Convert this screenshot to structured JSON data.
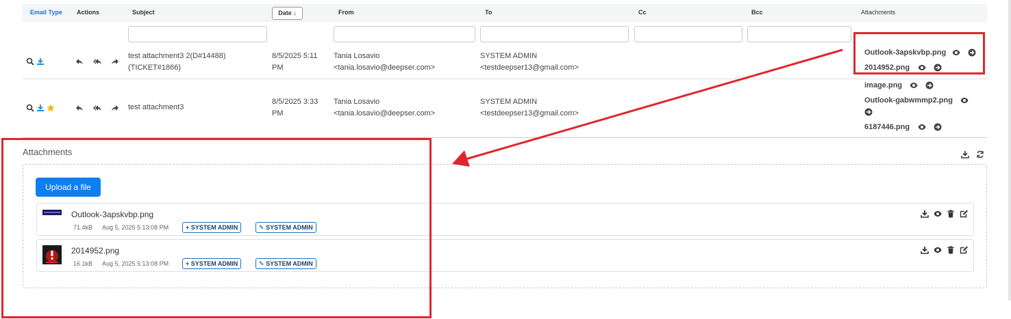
{
  "table": {
    "headers": {
      "email_type": "Email Type",
      "actions": "Actions",
      "subject": "Subject",
      "date": "Date",
      "from": "From",
      "to": "To",
      "cc": "Cc",
      "bcc": "Bcc",
      "attachments": "Attachments"
    },
    "rows": [
      {
        "subject_line1": "test attachment3 2(D#14488)",
        "subject_line2": "(TICKET#1866)",
        "date_line1": "8/5/2025 5:11",
        "date_line2": "PM",
        "from_name": "Tania Losavio",
        "from_email": "<tania.losavio@deepser.com>",
        "to_name": "SYSTEM ADMIN",
        "to_email": "<testdeepser13@gmail.com>",
        "attachments": [
          "Outlook-3apskvbp.png",
          "2014952.png"
        ]
      },
      {
        "subject_line1": "test attachment3",
        "date_line1": "8/5/2025 3:33",
        "date_line2": "PM",
        "from_name": "Tania Losavio",
        "from_email": "<tania.losavio@deepser.com>",
        "to_name": "SYSTEM ADMIN",
        "to_email": "<testdeepser13@gmail.com>",
        "attachments": [
          "image.png",
          "Outlook-gabwmmp2.png",
          "6187446.png"
        ]
      }
    ]
  },
  "panel": {
    "title": "Attachments",
    "upload_label": "Upload a file",
    "files": [
      {
        "name": "Outlook-3apskvbp.png",
        "size": "71.4kB",
        "date": "Aug 5, 2025 5:13:08 PM",
        "created_by": "+ SYSTEM ADMIN",
        "edited_by": "SYSTEM ADMIN"
      },
      {
        "name": "2014952.png",
        "size": "16.1kB",
        "date": "Aug 5, 2025 5:13:08 PM",
        "created_by": "+ SYSTEM ADMIN",
        "edited_by": "SYSTEM ADMIN"
      }
    ]
  },
  "colors": {
    "accent_blue": "#0d7ff2",
    "header_blue": "#1a73d9",
    "highlight_red": "#e0262b",
    "star": "#f5b400"
  },
  "icons": [
    "search-icon",
    "download-icon",
    "star-icon",
    "reply-icon",
    "reply-all-icon",
    "forward-icon",
    "eye-icon",
    "arrow-circle-right-icon",
    "refresh-icon",
    "trash-icon",
    "edit-icon",
    "pencil-icon",
    "plus-icon",
    "sort-down-icon"
  ]
}
